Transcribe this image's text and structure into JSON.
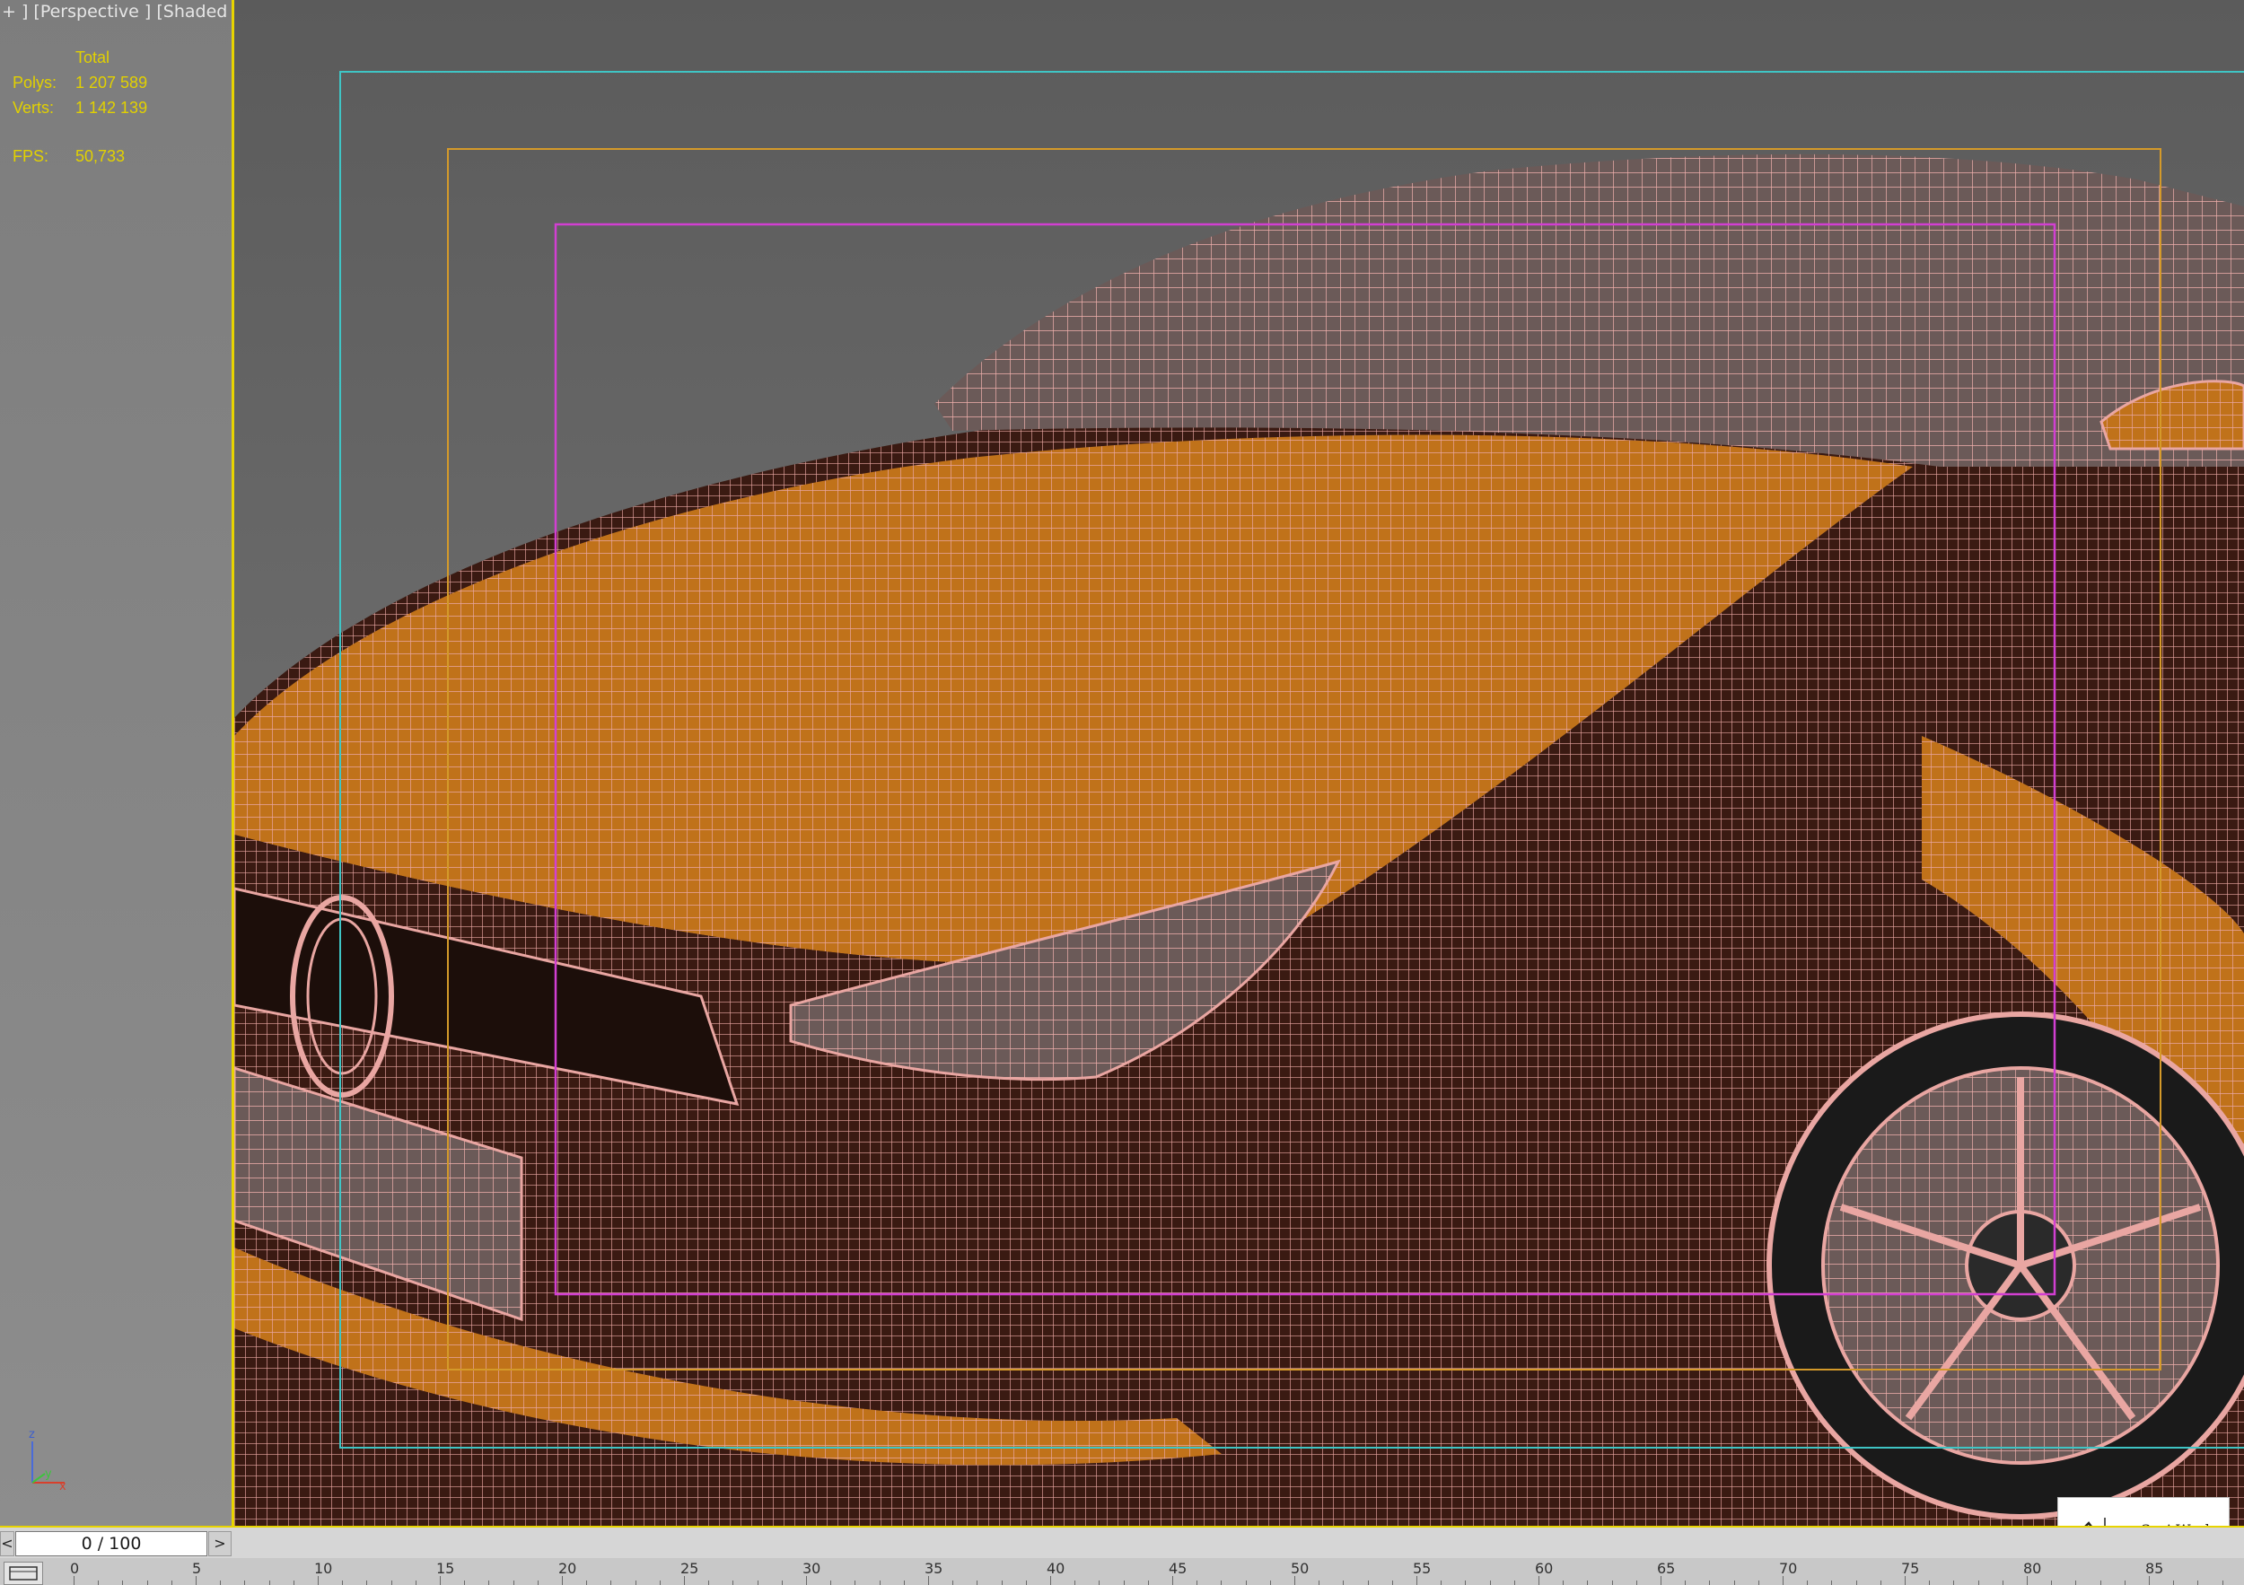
{
  "viewport": {
    "label": "+ ] [Perspective ] [Shaded + Edged Faces ]"
  },
  "stats": {
    "total_label": "Total",
    "polys_label": "Polys:",
    "polys_value": "1 207 589",
    "verts_label": "Verts:",
    "verts_value": "1 142 139",
    "fps_label": "FPS:",
    "fps_value": "50,733"
  },
  "axis": {
    "z": "z",
    "y": "y",
    "x": "x"
  },
  "time_slider": {
    "prev": "<",
    "value": "0 / 100",
    "next": ">"
  },
  "trackbar": {
    "ticks": [
      0,
      5,
      10,
      15,
      20,
      25,
      30,
      35,
      40,
      45,
      50,
      55,
      60,
      65,
      70,
      75,
      80,
      85
    ]
  },
  "logo": {
    "text": "Suri Works"
  },
  "colors": {
    "mesh_wire": "#e8a2a0",
    "mesh_fill": "#c8761a",
    "safe_frame_outer": "#3fc5c5",
    "safe_frame_mid": "#d49a2a",
    "safe_frame_inner": "#d23fd2",
    "stats_text": "#e2d100",
    "active_border": "#e8d400"
  }
}
